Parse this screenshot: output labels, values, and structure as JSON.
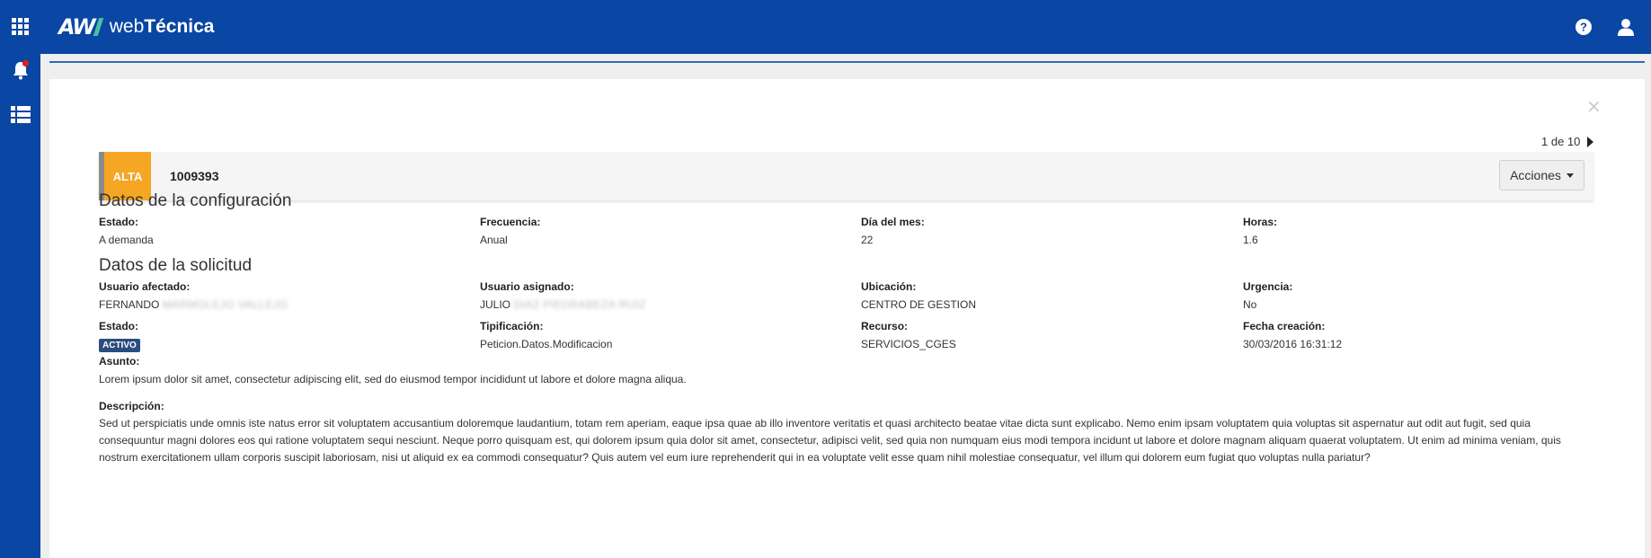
{
  "app": {
    "brand_mark": "AW",
    "brand_name_prefix": "web",
    "brand_name_bold": "Técnica"
  },
  "sidebar": {
    "items": [
      {
        "name": "apps-grid-icon"
      },
      {
        "name": "notifications-bell-icon"
      },
      {
        "name": "list-icon"
      }
    ]
  },
  "header": {
    "icons": [
      "help-icon",
      "user-icon"
    ]
  },
  "panel": {
    "close_label": "×",
    "pager": {
      "text": "1 de 10"
    },
    "record": {
      "type_badge": "ALTA",
      "id": "1009393",
      "actions_label": "Acciones"
    },
    "config": {
      "title": "Datos de la configuración",
      "fields": [
        {
          "label": "Estado:",
          "value": "A demanda"
        },
        {
          "label": "Frecuencia:",
          "value": "Anual"
        },
        {
          "label": "Día del mes:",
          "value": "22"
        },
        {
          "label": "Horas:",
          "value": "1.6"
        }
      ]
    },
    "request": {
      "title": "Datos de la solicitud",
      "affected_user": {
        "label": "Usuario afectado:",
        "value": "FERNANDO",
        "value_blurred": "MARMOLEJO VALLEJO"
      },
      "assigned_user": {
        "label": "Usuario asignado:",
        "value": "JULIO",
        "value_blurred": "DIAZ PIEDRABEZA RUIZ"
      },
      "location": {
        "label": "Ubicación:",
        "value": "CENTRO DE GESTION"
      },
      "urgency": {
        "label": "Urgencia:",
        "value": "No"
      },
      "status": {
        "label": "Estado:",
        "value": "ACTIVO"
      },
      "typification": {
        "label": "Tipificación:",
        "value": "Peticion.Datos.Modificacion"
      },
      "resource": {
        "label": "Recurso:",
        "value": "SERVICIOS_CGES"
      },
      "created": {
        "label": "Fecha creación:",
        "value": "30/03/2016 16:31:12"
      },
      "subject": {
        "label": "Asunto:",
        "value": "Lorem ipsum dolor sit amet, consectetur adipiscing elit, sed do eiusmod tempor incididunt ut labore et dolore magna aliqua."
      },
      "description": {
        "label": "Descripción:",
        "value": "Sed ut perspiciatis unde omnis iste natus error sit voluptatem accusantium doloremque laudantium, totam rem aperiam, eaque ipsa quae ab illo inventore veritatis et quasi architecto beatae vitae dicta sunt explicabo. Nemo enim ipsam voluptatem quia voluptas sit aspernatur aut odit aut fugit, sed quia consequuntur magni dolores eos qui ratione voluptatem sequi nesciunt. Neque porro quisquam est, qui dolorem ipsum quia dolor sit amet, consectetur, adipisci velit, sed quia non numquam eius modi tempora incidunt ut labore et dolore magnam aliquam quaerat voluptatem. Ut enim ad minima veniam, quis nostrum exercitationem ullam corporis suscipit laboriosam, nisi ut aliquid ex ea commodi consequatur? Quis autem vel eum iure reprehenderit qui in ea voluptate velit esse quam nihil molestiae consequatur, vel illum qui dolorem eum fugiat quo voluptas nulla pariatur?"
      }
    }
  },
  "colors": {
    "primary": "#0a46a3",
    "badge_alta": "#f5a623",
    "status_badge": "#2a4e7f",
    "notification_dot": "#e02020"
  }
}
